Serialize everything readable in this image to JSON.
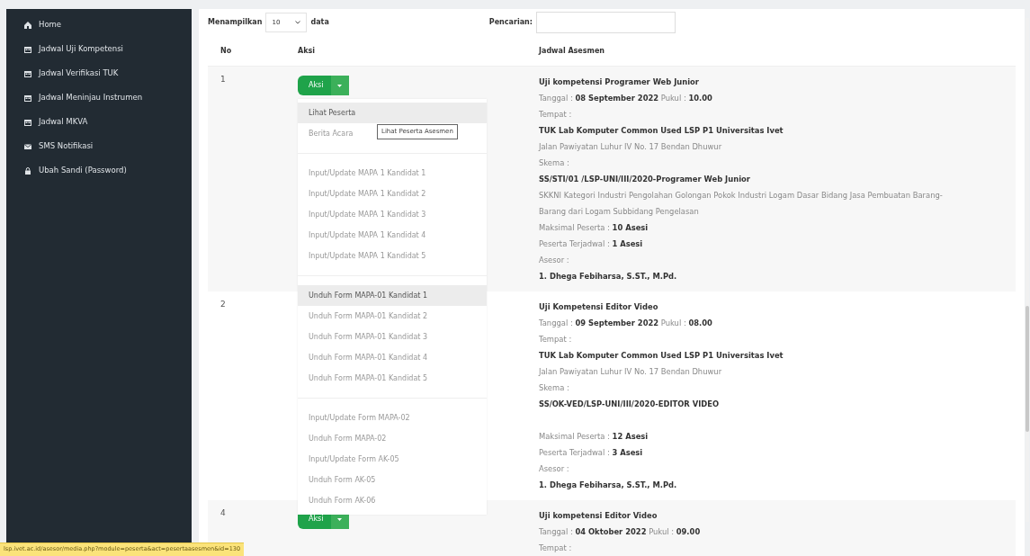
{
  "sidebar": {
    "items": [
      {
        "label": "Home",
        "kind": "home",
        "selected": false
      },
      {
        "label": "Jadwal Uji Kompetensi",
        "kind": "calendar",
        "selected": false
      },
      {
        "label": "Jadwal Verifikasi TUK",
        "kind": "calendar",
        "selected": false
      },
      {
        "label": "Jadwal Meninjau Instrumen",
        "kind": "calendar",
        "selected": false
      },
      {
        "label": "Jadwal MKVA",
        "kind": "calendar",
        "selected": false
      },
      {
        "label": "SMS Notifikasi",
        "kind": "envelope",
        "selected": false
      },
      {
        "label": "Ubah Sandi (Password)",
        "kind": "lock",
        "selected": false
      }
    ]
  },
  "toolbar": {
    "show_label": "Menampilkan",
    "page_size": "10",
    "show_suffix": "data",
    "search_label": "Pencarian:"
  },
  "table": {
    "columns": [
      "No",
      "Aksi",
      "Jadwal Asesmen"
    ],
    "rows": [
      {
        "no": "1",
        "button": "Aksi",
        "lines": [
          {
            "kind": "bold",
            "text": "Uji kompetensi Programer Web Junior"
          },
          {
            "kind": "plain",
            "text": "Tanggal : **08 September 2022** Pukul : **10.00**"
          },
          {
            "kind": "plain",
            "text": "Tempat :"
          },
          {
            "kind": "bold",
            "text": "TUK Lab Komputer Common Used LSP P1 Universitas Ivet"
          },
          {
            "kind": "plain",
            "text": "Jalan Pawiyatan Luhur IV No. 17 Bendan Dhuwur"
          },
          {
            "kind": "plain",
            "text": "Skema :"
          },
          {
            "kind": "bold",
            "text": "SS/STI/01 /LSP-UNI/III/2020-Programer Web Junior"
          },
          {
            "kind": "plain",
            "text": "SKKNI Kategori Industri Pengolahan Golongan Pokok Industri Logam Dasar Bidang Jasa Pembuatan Barang-Barang dari Logam Subbidang Pengelasan"
          },
          {
            "kind": "plain",
            "text": "Maksimal Peserta : **10 Asesi**"
          },
          {
            "kind": "plain",
            "text": "Peserta Terjadwal : **1 Asesi**"
          },
          {
            "kind": "plain",
            "text": "Asesor :"
          },
          {
            "kind": "bold",
            "text": "1. Dhega Febiharsa, S.ST., M.Pd."
          }
        ]
      },
      {
        "no": "2",
        "lines": [
          {
            "kind": "bold",
            "text": "Uji Kompetensi Editor Video"
          },
          {
            "kind": "plain",
            "text": "Tanggal : **09 September 2022** Pukul : **08.00**"
          },
          {
            "kind": "plain",
            "text": "Tempat :"
          },
          {
            "kind": "bold",
            "text": "TUK Lab Komputer Common Used LSP P1 Universitas Ivet"
          },
          {
            "kind": "plain",
            "text": "Jalan Pawiyatan Luhur IV No. 17 Bendan Dhuwur"
          },
          {
            "kind": "plain",
            "text": "Skema :"
          },
          {
            "kind": "bold",
            "text": "SS/OK-VED/LSP-UNI/III/2020-EDITOR VIDEO"
          },
          {
            "kind": "spacer"
          },
          {
            "kind": "plain",
            "text": "Maksimal Peserta : **12 Asesi**"
          },
          {
            "kind": "plain",
            "text": "Peserta Terjadwal : **3 Asesi**"
          },
          {
            "kind": "plain",
            "text": "Asesor :"
          },
          {
            "kind": "bold",
            "text": "1. Dhega Febiharsa, S.ST., M.Pd."
          }
        ]
      },
      {
        "no": "4",
        "button": "Aksi",
        "lines": [
          {
            "kind": "bold",
            "text": "Uji kompetensi Editor Video"
          },
          {
            "kind": "plain",
            "text": "Tanggal : **04 Oktober 2022** Pukul : **09.00**"
          },
          {
            "kind": "plain",
            "text": "Tempat :"
          }
        ]
      }
    ]
  },
  "dropdown": {
    "items": [
      {
        "kind": "item",
        "label": "Lihat Peserta",
        "selected": true
      },
      {
        "kind": "item",
        "label": "Berita Acara",
        "selected": false
      },
      {
        "kind": "divider"
      },
      {
        "kind": "item",
        "label": "Input/Update MAPA 1 Kandidat 1",
        "selected": false
      },
      {
        "kind": "item",
        "label": "Input/Update MAPA 1 Kandidat 2",
        "selected": false
      },
      {
        "kind": "item",
        "label": "Input/Update MAPA 1 Kandidat 3",
        "selected": false
      },
      {
        "kind": "item",
        "label": "Input/Update MAPA 1 Kandidat 4",
        "selected": false
      },
      {
        "kind": "item",
        "label": "Input/Update MAPA 1 Kandidat 5",
        "selected": false
      },
      {
        "kind": "divider"
      },
      {
        "kind": "item",
        "label": "Unduh Form MAPA-01 Kandidat 1",
        "selected": true
      },
      {
        "kind": "item",
        "label": "Unduh Form MAPA-01 Kandidat 2",
        "selected": false
      },
      {
        "kind": "item",
        "label": "Unduh Form MAPA-01 Kandidat 3",
        "selected": false
      },
      {
        "kind": "item",
        "label": "Unduh Form MAPA-01 Kandidat 4",
        "selected": false
      },
      {
        "kind": "item",
        "label": "Unduh Form MAPA-01 Kandidat 5",
        "selected": false
      },
      {
        "kind": "divider"
      },
      {
        "kind": "item",
        "label": "Input/Update Form MAPA-02",
        "selected": false
      },
      {
        "kind": "item",
        "label": "Unduh Form MAPA-02",
        "selected": false
      },
      {
        "kind": "item",
        "label": "Input/Update Form AK-05",
        "selected": false
      },
      {
        "kind": "item",
        "label": "Unduh Form AK-05",
        "selected": false
      },
      {
        "kind": "item",
        "label": "Unduh Form AK-06",
        "selected": false
      }
    ],
    "tooltip": "Lihat Peserta Asesmen"
  },
  "status_bar": {
    "url": "lsp.ivet.ac.id/asesor/media.php?module=peserta&act=pesertaasesmen&id=130"
  }
}
